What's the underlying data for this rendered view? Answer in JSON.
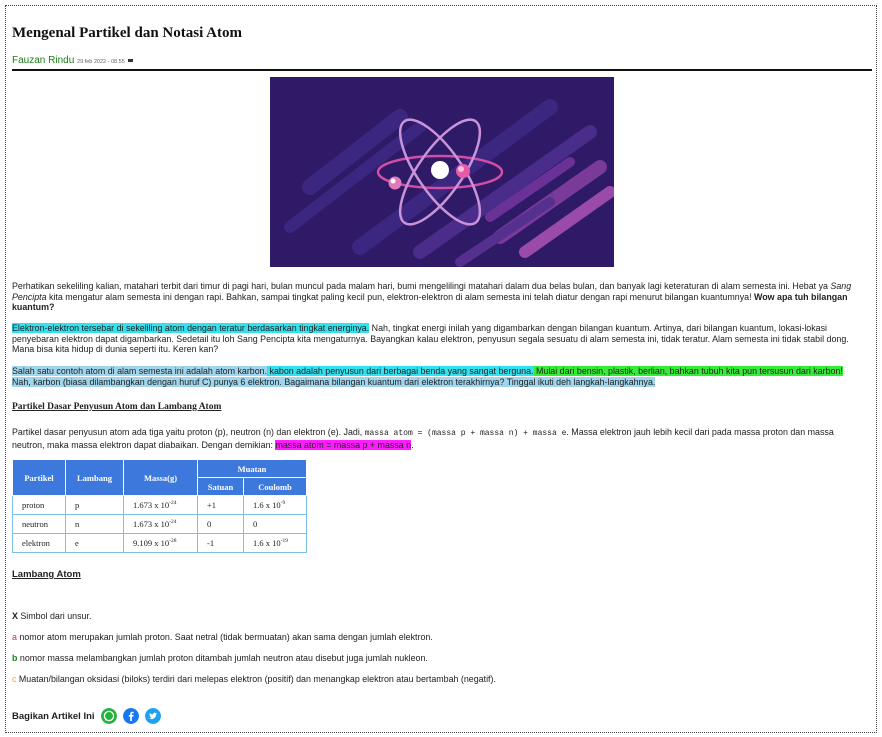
{
  "article": {
    "title": "Mengenal Partikel dan Notasi Atom",
    "author": "Fauzan Rindu",
    "date": "29 feb 2022 - 08.55"
  },
  "paragraphs": {
    "p1_a": "Perhatikan sekeliling kalian, matahari terbit dari timur di pagi hari, bulan muncul pada malam hari, bumi mengelilingi matahari dalam dua belas bulan, dan banyak lagi keteraturan di alam semesta ini. Hebat ya ",
    "p1_italic": "Sang Pencipta",
    "p1_b": " kita mengatur alam semesta ini dengan rapi. Bahkan, sampai tingkat paling kecil pun, elektron-elektron di alam semesta ini telah diatur dengan rapi menurut bilangan kuantumnya! ",
    "p1_bold": "Wow apa tuh bilangan kuantum?",
    "p2_hl": "Elektron-elektron tersebar di sekeliling atom dengan teratur berdasarkan tingkat energinya.",
    "p2_rest": " Nah, tingkat energi inilah yang digambarkan dengan bilangan kuantum. Artinya, dari bilangan kuantum, lokasi-lokasi penyebaran elektron dapat digambarkan. Sedetail itu loh Sang Pencipta kita mengaturnya. Bayangkan kalau elektron, penyusun segala sesuatu di alam semesta ini, tidak teratur. Alam semesta ini tidak stabil dong. Mana bisa kita hidup di dunia seperti itu. Keren kan?",
    "p3_a": "Salah satu contoh atom di alam semesta ini adalah atom karbon.",
    "p3_b": " kabon adalah penyusun dari berbagai benda yang sangat berguna.",
    "p3_c": " Mulai dari bensin, plastik, berlian, bahkan tubuh kita pun tersusun dari karbon!",
    "p3_d": " Nah, karbon (biasa dilambangkan dengan huruf C) punya 6 elektron. Bagaimana bilangan kuantum dari elektron terakhirnya? Tinggal ikuti deh langkah-langkahnya.",
    "heading1": "Partikel Dasar Penyusun Atom dan Lambang Atom",
    "p4_a": "Partikel dasar penyusun atom ada tiga yaitu proton (p), neutron (n) dan elektron (e). Jadi, ",
    "p4_mono": "massa atom = (massa p + massa n) + massa e",
    "p4_b": ". Massa elektron jauh lebih kecil dari pada massa proton dan massa neutron, maka massa elektron dapat diabaikan. Dengan demikian: ",
    "p4_hl": "massa atom = massa p + massa n",
    "p4_end": ".",
    "heading2": "Lambang Atom"
  },
  "table": {
    "headers": {
      "partikel": "Partikel",
      "lambang": "Lambang",
      "massa": "Massa(g)",
      "muatan": "Muatan",
      "satuan": "Satuan",
      "coulomb": "Coulomb"
    },
    "rows": [
      {
        "partikel": "proton",
        "lambang": "p",
        "massa": "1.673 x 10",
        "massa_exp": "-24",
        "satuan": "+1",
        "coulomb": "1.6 x 10",
        "coulomb_exp": "-9"
      },
      {
        "partikel": "neutron",
        "lambang": "n",
        "massa": "1.673 x 10",
        "massa_exp": "-24",
        "satuan": "0",
        "coulomb": "0",
        "coulomb_exp": ""
      },
      {
        "partikel": "elektron",
        "lambang": "e",
        "massa": "9.109 x 10",
        "massa_exp": "-28",
        "satuan": "-1",
        "coulomb": "1.6 x 10",
        "coulomb_exp": "-19"
      }
    ]
  },
  "legend": [
    {
      "key": "X",
      "text": " Simbol dari unsur."
    },
    {
      "key": "a",
      "text": " nomor atom merupakan jumlah proton. Saat netral (tidak bermuatan) akan sama dengan jumlah elektron."
    },
    {
      "key": "b",
      "text": " nomor massa melambangkan jumlah proton ditambah jumlah neutron atau disebut juga jumlah nukleon."
    },
    {
      "key": "c",
      "text": " Muatan/bilangan oksidasi (biloks) terdiri dari melepas elektron (positif) dan menangkap elektron atau bertambah (negatif)."
    }
  ],
  "share": {
    "label": "Bagikan Artikel Ini",
    "icons": [
      "whatsapp-icon",
      "facebook-icon",
      "twitter-icon"
    ],
    "colors": {
      "whatsapp": "#25b23f",
      "facebook": "#1877f2",
      "twitter": "#1da1f2"
    }
  },
  "colors": {
    "author": "#1a7f1a",
    "table_header": "#3d78dc",
    "hero_bg": "#2e1a66"
  }
}
